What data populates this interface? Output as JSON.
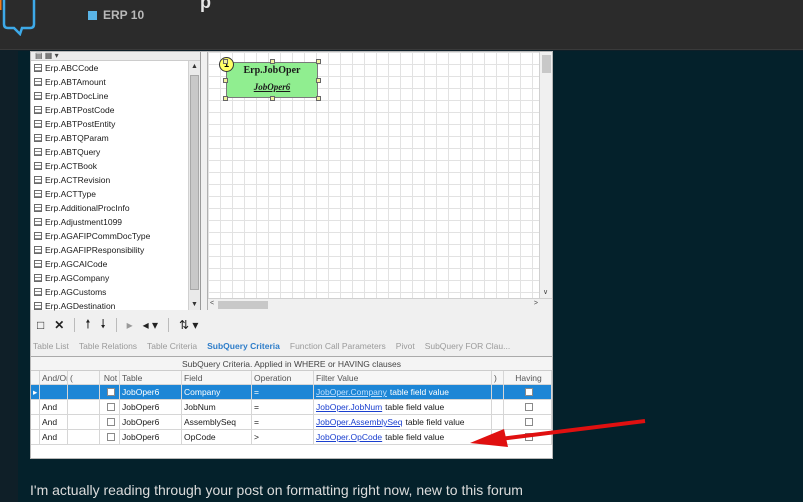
{
  "forum": {
    "title_fragment": "p",
    "category": "ERP 10",
    "category_color": "#5ab4e6",
    "post_text": "I'm actually reading through your post on formatting right now, new to this forum"
  },
  "tables": [
    "Erp.ABCCode",
    "Erp.ABTAmount",
    "Erp.ABTDocLine",
    "Erp.ABTPostCode",
    "Erp.ABTPostEntity",
    "Erp.ABTQParam",
    "Erp.ABTQuery",
    "Erp.ACTBook",
    "Erp.ACTRevision",
    "Erp.ACTType",
    "Erp.AdditionalProcInfo",
    "Erp.Adjustment1099",
    "Erp.AGAFIPCommDocType",
    "Erp.AGAFIPResponsibility",
    "Erp.AGCAICode",
    "Erp.AGCompany",
    "Erp.AGCustoms",
    "Erp.AGDestination"
  ],
  "designer": {
    "table_title": "Erp.JobOper",
    "table_alias": "JobOper6",
    "badge": "1",
    "box_color": "#90ee90"
  },
  "tabs": [
    {
      "label": "Table List"
    },
    {
      "label": "Table Relations"
    },
    {
      "label": "Table Criteria"
    },
    {
      "label": "SubQuery Criteria"
    },
    {
      "label": "Function Call Parameters"
    },
    {
      "label": "Pivot"
    },
    {
      "label": "SubQuery FOR Clau..."
    }
  ],
  "grid": {
    "caption": "SubQuery Criteria. Applied in WHERE or HAVING clauses",
    "headers": {
      "andor": "And/Or",
      "lparen": "(",
      "not": "Not",
      "table": "Table",
      "field": "Field",
      "op": "Operation",
      "filter": "Filter Value",
      "rparen": ")",
      "having": "Having"
    },
    "rows": [
      {
        "andor": "",
        "table": "JobOper6",
        "field": "Company",
        "op": "=",
        "filter_link": "JobOper.Company",
        "filter_suffix": "table field value"
      },
      {
        "andor": "And",
        "table": "JobOper6",
        "field": "JobNum",
        "op": "=",
        "filter_link": "JobOper.JobNum",
        "filter_suffix": "table field value"
      },
      {
        "andor": "And",
        "table": "JobOper6",
        "field": "AssemblySeq",
        "op": "=",
        "filter_link": "JobOper.AssemblySeq",
        "filter_suffix": "table field value"
      },
      {
        "andor": "And",
        "table": "JobOper6",
        "field": "OpCode",
        "op": ">",
        "filter_link": "JobOper.OpCode",
        "filter_suffix": "table field value"
      }
    ]
  },
  "colors": {
    "selection": "#1d86d6",
    "annotation_arrow": "#e01010",
    "active_tab": "#2e7dc9"
  }
}
